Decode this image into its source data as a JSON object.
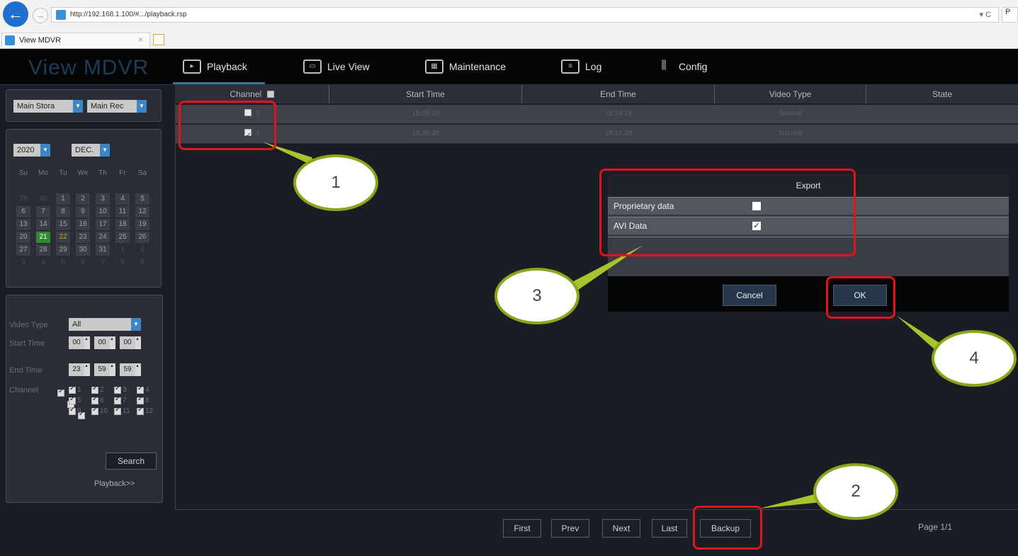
{
  "browser": {
    "url": "http://192.168.1.100/#.../playback.rsp",
    "tab_title": "View MDVR",
    "url_controls": "▾ C",
    "right_box": "P",
    "tab_close": "×"
  },
  "app": {
    "logo": "View MDVR",
    "nav": [
      {
        "label": "Playback",
        "icon": "playback-icon",
        "active": true
      },
      {
        "label": "Live View",
        "icon": "live-view-icon"
      },
      {
        "label": "Maintenance",
        "icon": "maintenance-icon"
      },
      {
        "label": "Log",
        "icon": "log-icon"
      },
      {
        "label": "Config",
        "icon": "config-icon"
      }
    ]
  },
  "sidebar": {
    "storage_select": "Main Stora",
    "record_select": "Main Rec",
    "year": "2020",
    "month": "DEC.",
    "weekdays": [
      "Su",
      "Mo",
      "Tu",
      "We",
      "Th",
      "Fr",
      "Sa"
    ],
    "weeks": [
      [
        "29",
        "30",
        "1",
        "2",
        "3",
        "4",
        "5"
      ],
      [
        "6",
        "7",
        "8",
        "9",
        "10",
        "11",
        "12"
      ],
      [
        "13",
        "14",
        "15",
        "16",
        "17",
        "18",
        "19"
      ],
      [
        "20",
        "21",
        "22",
        "23",
        "24",
        "25",
        "26"
      ],
      [
        "27",
        "28",
        "29",
        "30",
        "31",
        "1",
        "2"
      ],
      [
        "3",
        "4",
        "5",
        "6",
        "7",
        "8",
        "9"
      ]
    ],
    "video_type_label": "Video Type",
    "video_type_value": "All",
    "start_time_label": "Start Time",
    "start_time": [
      "00",
      "00",
      "00"
    ],
    "end_time_label": "End Time",
    "end_time": [
      "23",
      "59",
      "59"
    ],
    "channel_label": "Channel",
    "channels": [
      "1",
      "2",
      "3",
      "4",
      "5",
      "6",
      "7",
      "8",
      "9",
      "10",
      "11",
      "12"
    ],
    "search_button": "Search",
    "playback_link": "Playback>>"
  },
  "table": {
    "headers": [
      "Channel",
      "Start Time",
      "End Time",
      "Video Type",
      "State"
    ],
    "rows": [
      {
        "checked": false,
        "channel": "1",
        "start": "18:06:18",
        "end": "18:14:18",
        "type": "Normal",
        "state": ""
      },
      {
        "checked": true,
        "channel": "1",
        "start": "18:06:28",
        "end": "18:14:28",
        "type": "Normal",
        "state": ""
      }
    ]
  },
  "pager": {
    "first": "First",
    "prev": "Prev",
    "next": "Next",
    "last": "Last",
    "backup": "Backup",
    "page": "Page 1/1"
  },
  "export_dialog": {
    "title": "Export",
    "options": [
      {
        "label": "Proprietary data",
        "checked": false
      },
      {
        "label": "AVI Data",
        "checked": true
      }
    ],
    "cancel": "Cancel",
    "ok": "OK"
  },
  "annotations": [
    "1",
    "2",
    "3",
    "4"
  ],
  "colors": {
    "annotation_box": "#e0141c",
    "callout_border": "#88a81a",
    "today_highlight": "#2e8b2e"
  }
}
